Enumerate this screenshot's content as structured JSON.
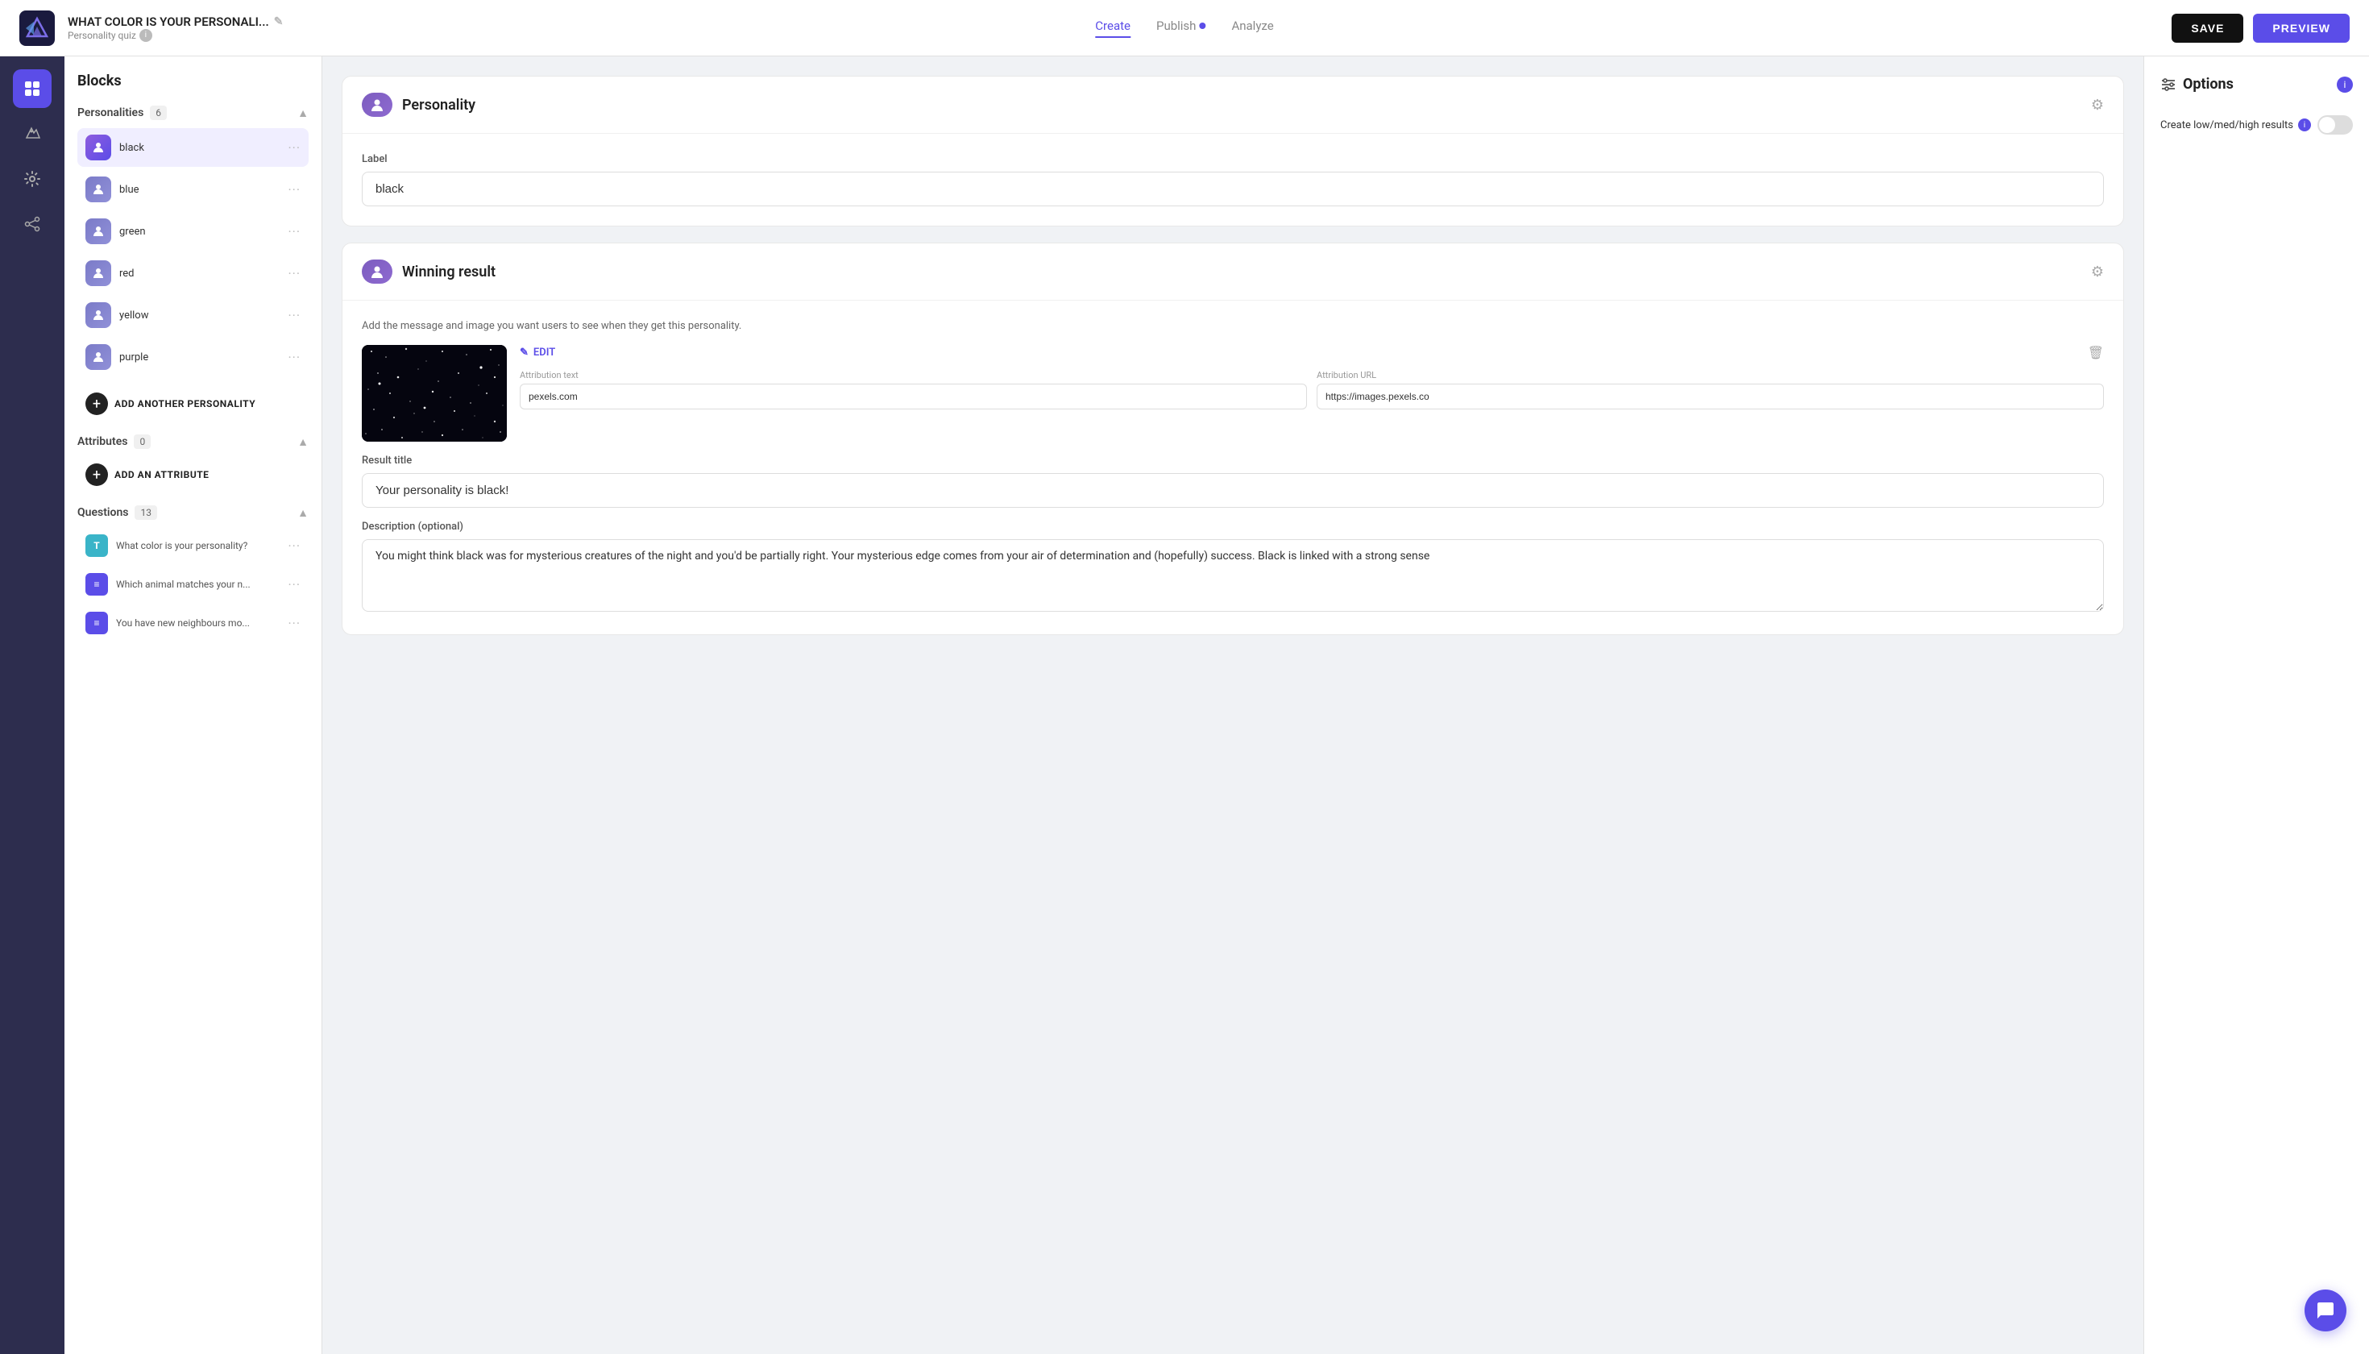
{
  "app": {
    "logo_alt": "Interact logo",
    "title": "WHAT COLOR IS YOUR PERSONALI...",
    "subtitle": "Personality quiz",
    "edit_icon": "✎"
  },
  "nav": {
    "tabs": [
      {
        "id": "create",
        "label": "Create",
        "active": true,
        "dot": false
      },
      {
        "id": "publish",
        "label": "Publish",
        "active": false,
        "dot": true
      },
      {
        "id": "analyze",
        "label": "Analyze",
        "active": false,
        "dot": false
      }
    ],
    "save_label": "SAVE",
    "preview_label": "PREVIEW"
  },
  "icon_sidebar": {
    "items": [
      {
        "id": "blocks",
        "icon": "⊞",
        "active": true
      },
      {
        "id": "style",
        "icon": "🖌",
        "active": false
      },
      {
        "id": "settings",
        "icon": "⚙",
        "active": false
      },
      {
        "id": "share",
        "icon": "↗",
        "active": false
      }
    ]
  },
  "blocks_panel": {
    "title": "Blocks",
    "sections": {
      "personalities": {
        "label": "Personalities",
        "count": 6,
        "collapsed": false,
        "items": [
          {
            "id": "black",
            "name": "black",
            "color": "#5b4de8",
            "active": true
          },
          {
            "id": "blue",
            "name": "blue",
            "color": "#7b7bb8",
            "active": false
          },
          {
            "id": "green",
            "name": "green",
            "color": "#7b7bb8",
            "active": false
          },
          {
            "id": "red",
            "name": "red",
            "color": "#7b7bb8",
            "active": false
          },
          {
            "id": "yellow",
            "name": "yellow",
            "color": "#7b7bb8",
            "active": false
          },
          {
            "id": "purple",
            "name": "purple",
            "color": "#7b7bb8",
            "active": false
          }
        ],
        "add_label": "ADD ANOTHER PERSONALITY"
      },
      "attributes": {
        "label": "Attributes",
        "count": 0,
        "collapsed": false,
        "add_label": "ADD AN ATTRIBUTE"
      },
      "questions": {
        "label": "Questions",
        "count": 13,
        "collapsed": false,
        "items": [
          {
            "id": "q1",
            "badge": "T",
            "badge_color": "#3ab4c8",
            "text": "What color is your personality?"
          },
          {
            "id": "q2",
            "badge": "≡",
            "badge_color": "#5b4de8",
            "text": "Which animal matches your n..."
          },
          {
            "id": "q3",
            "badge": "≡",
            "badge_color": "#5b4de8",
            "text": "You have new neighbours mo..."
          }
        ]
      }
    }
  },
  "personality_card": {
    "title": "Personality",
    "label_field": "Label",
    "label_value": "black",
    "label_placeholder": "black"
  },
  "winning_result_card": {
    "title": "Winning result",
    "instruction": "Add the message and image you want users to see when they get this personality.",
    "edit_label": "EDIT",
    "attribution_text_label": "Attribution text",
    "attribution_text_value": "pexels.com",
    "attribution_url_label": "Attribution URL",
    "attribution_url_value": "https://images.pexels.co",
    "result_title_label": "Result title",
    "result_title_value": "Your personality is black!",
    "result_title_placeholder": "Your personality is black!",
    "description_label": "Description (optional)",
    "description_value": "You might think black was for mysterious creatures of the night and you'd be partially right. Your mysterious edge comes from your air of determination and (hopefully) success. Black is linked with a strong sense"
  },
  "options_panel": {
    "title": "Options",
    "info": "i",
    "options": [
      {
        "id": "low-med-high",
        "label": "Create low/med/high results",
        "info": true,
        "toggled": false
      }
    ]
  },
  "chat_button": {
    "icon": "💬"
  }
}
